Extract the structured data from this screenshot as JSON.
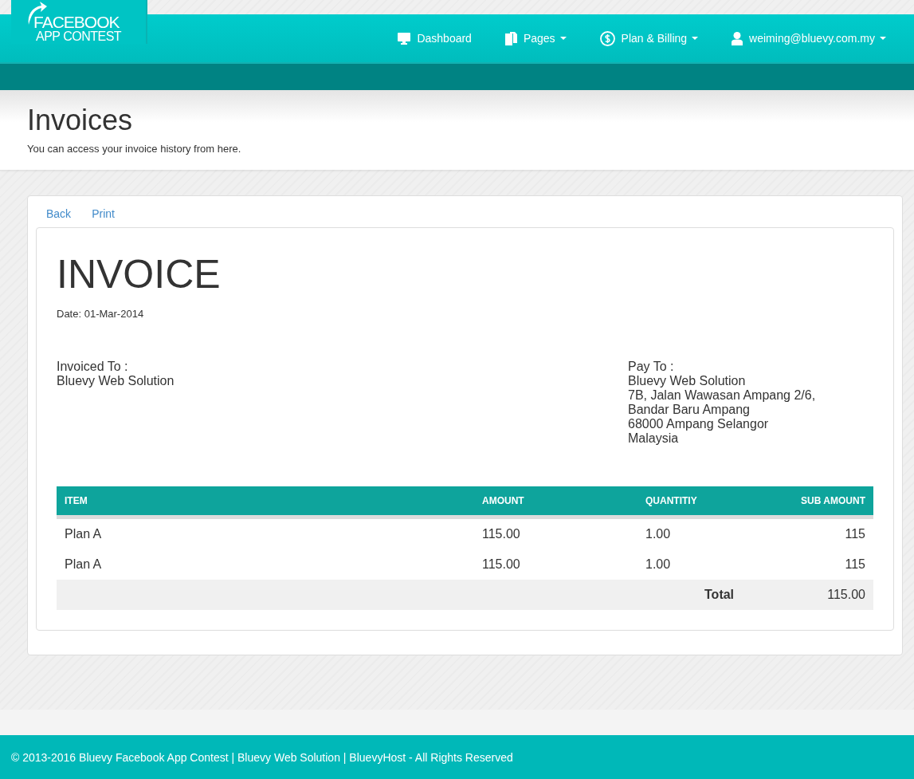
{
  "logo": {
    "line_1": "FACEBOOK",
    "line_2": "APP CONTEST"
  },
  "nav": [
    {
      "kind": "monitor",
      "label": "Dashboard",
      "dropdown": false
    },
    {
      "kind": "pages",
      "label": "Pages",
      "dropdown": true
    },
    {
      "kind": "dollar",
      "label": "Plan & Billing",
      "dropdown": true
    },
    {
      "kind": "user",
      "label": "weiming@bluevy.com.my",
      "dropdown": true
    }
  ],
  "page_header": {
    "title": "Invoices",
    "subtitle": "You can access your invoice history from here."
  },
  "actions": [
    "Back",
    "Print"
  ],
  "invoice": {
    "title": "INVOICE",
    "date": "Date: 01-Mar-2014",
    "invoiced_to": {
      "label": "Invoiced To :",
      "lines": [
        "Bluevy Web Solution"
      ]
    },
    "pay_to": {
      "label": "Pay To :",
      "lines": [
        "Bluevy Web Solution",
        "7B, Jalan Wawasan Ampang 2/6,",
        "Bandar Baru Ampang",
        "68000 Ampang Selangor",
        "Malaysia"
      ]
    },
    "table": {
      "columns": [
        "ITEM",
        "AMOUNT",
        "QUANTITIY",
        "SUB AMOUNT"
      ],
      "rows": [
        [
          "Plan A",
          "115.00",
          "1.00",
          "115"
        ],
        [
          "Plan A",
          "115.00",
          "1.00",
          "115"
        ]
      ],
      "total_label": "Total",
      "total_value": "115.00"
    }
  },
  "footer": "© 2013-2016 Bluevy Facebook App Contest | Bluevy Web Solution | BluevyHost - All Rights Reserved"
}
